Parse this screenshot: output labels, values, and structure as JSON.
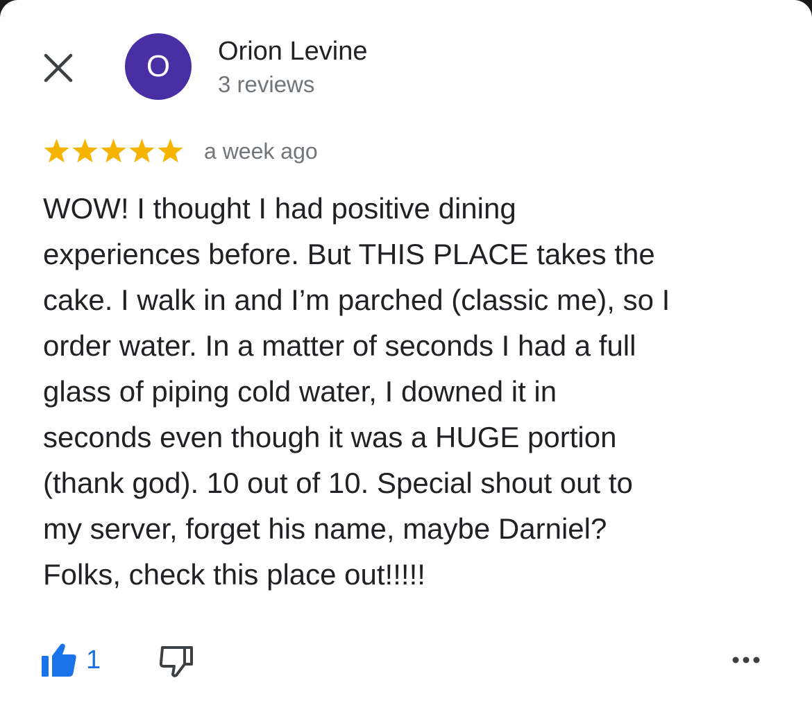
{
  "reviewer": {
    "initial": "O",
    "name": "Orion Levine",
    "review_count": "3 reviews",
    "avatar_color": "#4a2ea3"
  },
  "review": {
    "rating": 5,
    "max_rating": 5,
    "star_color": "#f4b400",
    "date": "a week ago",
    "text_lines": [
      "WOW! I thought I had positive dining",
      "experiences before. But THIS PLACE takes the",
      "cake. I walk in and I’m parched (classic me), so I",
      "order water. In a matter of seconds I had a full",
      "glass of piping cold water, I downed it in",
      "seconds even though it was a HUGE portion",
      "(thank god). 10 out of 10. Special shout out to",
      "my server, forget his name, maybe Darniel?",
      "Folks, check this place out!!!!!"
    ]
  },
  "actions": {
    "like_count": "1",
    "like_color": "#1a73e8",
    "icons": {
      "close": "close-icon",
      "like": "thumbs-up-icon",
      "dislike": "thumbs-down-icon",
      "more": "more-horizontal-icon"
    }
  }
}
